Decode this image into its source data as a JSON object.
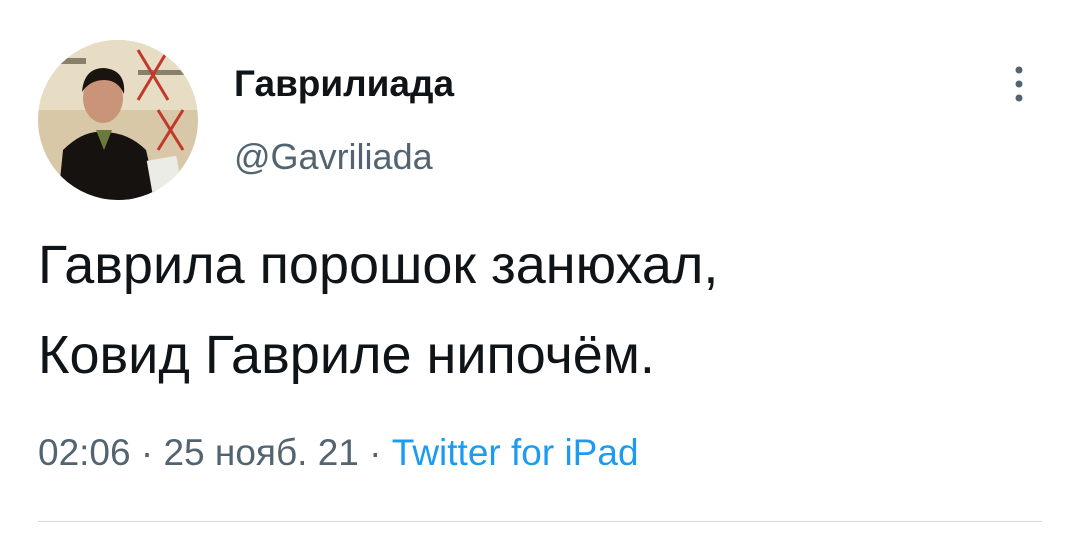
{
  "tweet": {
    "author": {
      "display_name": "Гаврилиада",
      "handle": "@Gavriliada",
      "avatar": "profile-photo"
    },
    "text_lines": [
      "Гаврила порошок занюхал,",
      "Ковид Гавриле нипочём."
    ],
    "time": "02:06",
    "date": "25 нояб. 21",
    "separator": "·",
    "source": "Twitter for iPad",
    "more_icon": "vertical-ellipsis-icon"
  },
  "colors": {
    "text": "#0f1419",
    "secondary": "#536471",
    "link": "#1d9bf0",
    "divider": "#cfd9de"
  }
}
